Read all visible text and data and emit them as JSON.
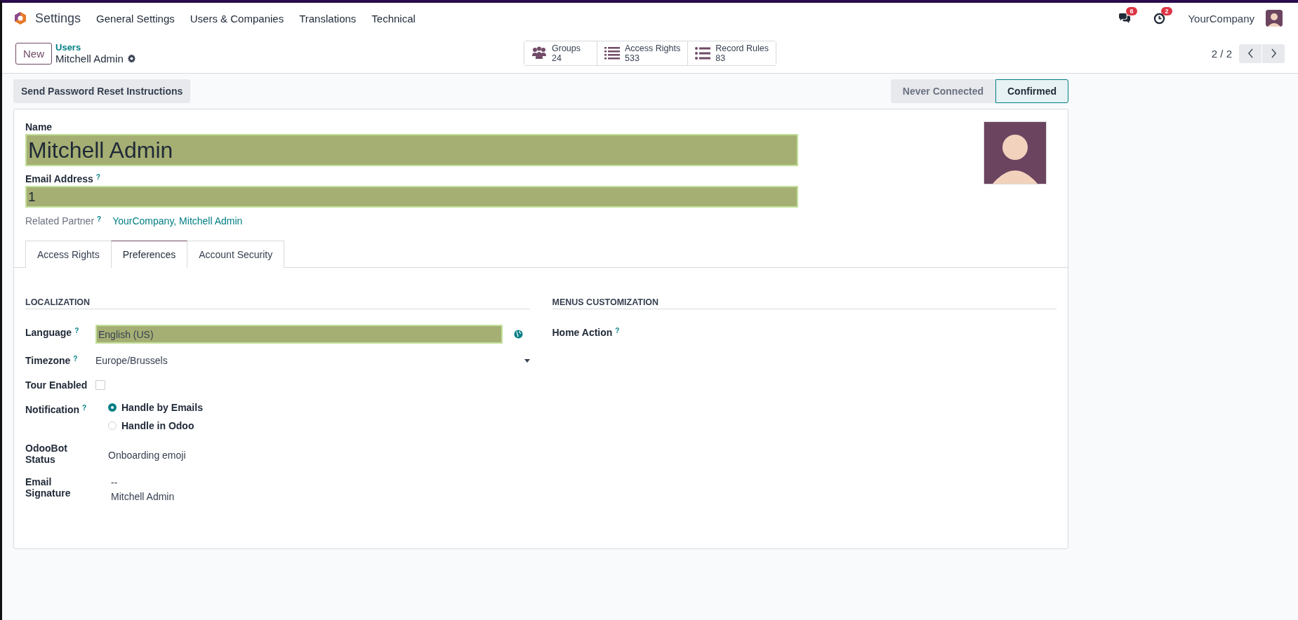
{
  "navbar": {
    "app_name": "Settings",
    "menus": [
      "General Settings",
      "Users & Companies",
      "Translations",
      "Technical"
    ],
    "messages_count": "6",
    "activities_count": "2",
    "company": "YourCompany"
  },
  "control_panel": {
    "new_button": "New",
    "breadcrumb_parent": "Users",
    "breadcrumb_current": "Mitchell Admin",
    "smart_buttons": [
      {
        "kind": "groups",
        "label": "Groups",
        "count": "24"
      },
      {
        "kind": "list",
        "label": "Access Rights",
        "count": "533"
      },
      {
        "kind": "bullets",
        "label": "Record Rules",
        "count": "83"
      }
    ],
    "pager": "2 / 2"
  },
  "action_buttons": [
    "Send Password Reset Instructions"
  ],
  "status_stages": [
    {
      "label": "Never Connected",
      "selected": false
    },
    {
      "label": "Confirmed",
      "selected": true
    }
  ],
  "form": {
    "name_label": "Name",
    "name_value": "Mitchell Admin",
    "email_label": "Email Address",
    "email_help": "?",
    "email_value": "1",
    "partner_label": "Related Partner",
    "partner_help": "?",
    "partner_value": "YourCompany, Mitchell Admin",
    "tabs": [
      {
        "label": "Access Rights",
        "selected": false
      },
      {
        "label": "Preferences",
        "selected": true
      },
      {
        "label": "Account Security",
        "selected": false
      }
    ],
    "sections": [
      {
        "title": "LOCALIZATION",
        "fields": [
          {
            "kind": "language",
            "label": "Language",
            "help": "?",
            "value": "English (US)"
          },
          {
            "kind": "select",
            "label": "Timezone",
            "help": "?",
            "value": "Europe/Brussels"
          },
          {
            "kind": "checkbox",
            "label": "Tour Enabled",
            "checked": false
          },
          {
            "kind": "radio",
            "label": "Notification",
            "help": "?",
            "options": [
              {
                "label": "Handle by Emails",
                "selected": true
              },
              {
                "label": "Handle in Odoo",
                "selected": false
              }
            ]
          },
          {
            "kind": "text",
            "label": "OdooBot Status",
            "value": "Onboarding emoji"
          },
          {
            "kind": "lines",
            "label": "Email Signature",
            "lines": [
              "--",
              "Mitchell Admin"
            ]
          }
        ]
      },
      {
        "title": "MENUS CUSTOMIZATION",
        "fields": [
          {
            "kind": "empty",
            "label": "Home Action",
            "help": "?"
          }
        ]
      }
    ]
  }
}
